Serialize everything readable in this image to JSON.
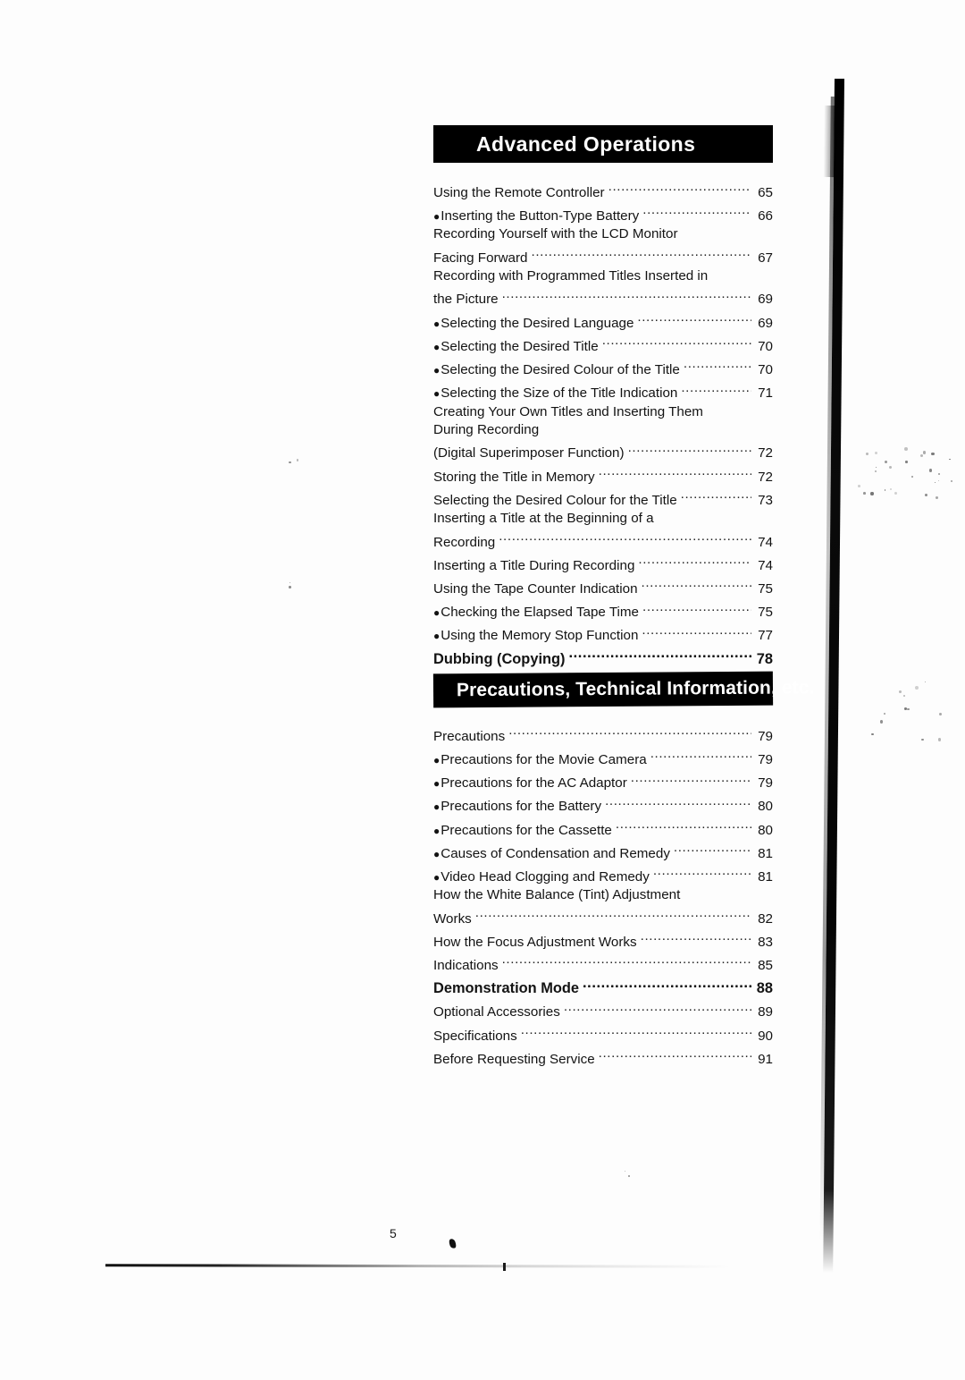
{
  "page": {
    "number": "5"
  },
  "sections": [
    {
      "title": "Advanced Operations",
      "entries": [
        {
          "bullet": false,
          "label": "Using the Remote Controller",
          "page": "65",
          "leader": true,
          "bold": false
        },
        {
          "bullet": true,
          "label": "Inserting the Button-Type Battery",
          "page": "66",
          "leader": true,
          "bold": false
        },
        {
          "bullet": false,
          "label": "Recording Yourself with the LCD Monitor",
          "page": "",
          "leader": false,
          "bold": false
        },
        {
          "bullet": false,
          "label": "Facing Forward",
          "page": "67",
          "leader": true,
          "bold": false
        },
        {
          "bullet": false,
          "label": "Recording with Programmed Titles Inserted in",
          "page": "",
          "leader": false,
          "bold": false
        },
        {
          "bullet": false,
          "label": "the Picture",
          "page": "69",
          "leader": true,
          "bold": false
        },
        {
          "bullet": true,
          "label": "Selecting the Desired Language",
          "page": "69",
          "leader": true,
          "bold": false
        },
        {
          "bullet": true,
          "label": "Selecting the Desired Title",
          "page": "70",
          "leader": true,
          "bold": false
        },
        {
          "bullet": true,
          "label": "Selecting the Desired Colour of the Title",
          "page": "70",
          "leader": true,
          "bold": false
        },
        {
          "bullet": true,
          "label": "Selecting the Size of the Title Indication",
          "page": "71",
          "leader": true,
          "bold": false
        },
        {
          "bullet": false,
          "label": "Creating Your Own Titles and Inserting Them",
          "page": "",
          "leader": false,
          "bold": false
        },
        {
          "bullet": false,
          "label": "During Recording",
          "page": "",
          "leader": false,
          "bold": false
        },
        {
          "bullet": false,
          "label": "(Digital Superimposer Function)",
          "page": "72",
          "leader": true,
          "bold": false
        },
        {
          "bullet": false,
          "label": "Storing the Title in Memory",
          "page": "72",
          "leader": true,
          "bold": false
        },
        {
          "bullet": false,
          "label": "Selecting the Desired Colour for the Title",
          "page": "73",
          "leader": true,
          "bold": false
        },
        {
          "bullet": false,
          "label": "Inserting a Title at the Beginning of a",
          "page": "",
          "leader": false,
          "bold": false
        },
        {
          "bullet": false,
          "label": "Recording",
          "page": "74",
          "leader": true,
          "bold": false
        },
        {
          "bullet": false,
          "label": "Inserting a Title During Recording",
          "page": "74",
          "leader": true,
          "bold": false
        },
        {
          "bullet": false,
          "label": "Using the Tape Counter Indication",
          "page": "75",
          "leader": true,
          "bold": false
        },
        {
          "bullet": true,
          "label": "Checking the Elapsed Tape Time",
          "page": "75",
          "leader": true,
          "bold": false
        },
        {
          "bullet": true,
          "label": "Using the Memory Stop Function",
          "page": "77",
          "leader": true,
          "bold": false
        },
        {
          "bullet": false,
          "label": "Dubbing (Copying)",
          "page": "78",
          "leader": true,
          "bold": true
        }
      ]
    },
    {
      "title": "Precautions, Technical Information, etc.",
      "entries": [
        {
          "bullet": false,
          "label": "Precautions",
          "page": "79",
          "leader": true,
          "bold": false
        },
        {
          "bullet": true,
          "label": "Precautions for the Movie Camera",
          "page": "79",
          "leader": true,
          "bold": false
        },
        {
          "bullet": true,
          "label": "Precautions for the AC Adaptor",
          "page": "79",
          "leader": true,
          "bold": false
        },
        {
          "bullet": true,
          "label": "Precautions for the Battery",
          "page": "80",
          "leader": true,
          "bold": false
        },
        {
          "bullet": true,
          "label": "Precautions for the Cassette",
          "page": "80",
          "leader": true,
          "bold": false
        },
        {
          "bullet": true,
          "label": "Causes of Condensation and Remedy",
          "page": "81",
          "leader": true,
          "bold": false
        },
        {
          "bullet": true,
          "label": "Video Head Clogging and Remedy",
          "page": "81",
          "leader": true,
          "bold": false
        },
        {
          "bullet": false,
          "label": "How the White Balance (Tint) Adjustment",
          "page": "",
          "leader": false,
          "bold": false
        },
        {
          "bullet": false,
          "label": "Works",
          "page": "82",
          "leader": true,
          "bold": false
        },
        {
          "bullet": false,
          "label": "How the Focus Adjustment Works",
          "page": "83",
          "leader": true,
          "bold": false
        },
        {
          "bullet": false,
          "label": "Indications",
          "page": "85",
          "leader": true,
          "bold": false
        },
        {
          "bullet": false,
          "label": "Demonstration Mode",
          "page": "88",
          "leader": true,
          "bold": true
        },
        {
          "bullet": false,
          "label": "Optional Accessories",
          "page": "89",
          "leader": true,
          "bold": false
        },
        {
          "bullet": false,
          "label": "Specifications",
          "page": "90",
          "leader": true,
          "bold": false
        },
        {
          "bullet": false,
          "label": "Before Requesting Service",
          "page": "91",
          "leader": true,
          "bold": false
        }
      ]
    }
  ]
}
